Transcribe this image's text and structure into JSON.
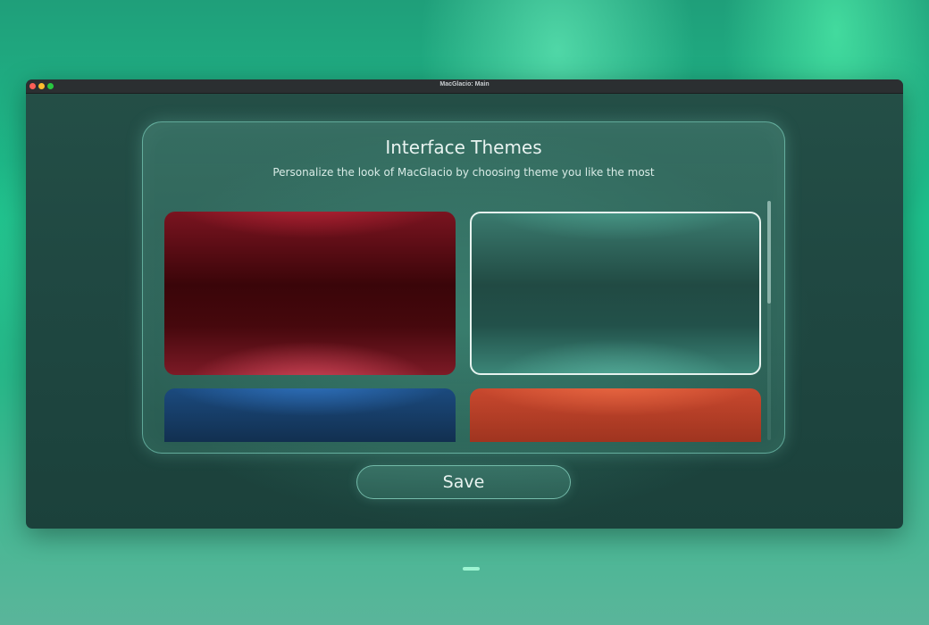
{
  "window": {
    "title": "MacGlacio: Main"
  },
  "panel": {
    "title": "Interface Themes",
    "subtitle": "Personalize the look of MacGlacio by choosing theme you like the most"
  },
  "themes": [
    {
      "name": "red-theme",
      "color": "#3a0509",
      "selected": false
    },
    {
      "name": "glacier-theme",
      "color": "#214a43",
      "selected": true
    },
    {
      "name": "blue-theme",
      "color": "#0d2238",
      "selected": false
    },
    {
      "name": "orange-theme",
      "color": "#c8482e",
      "selected": false
    }
  ],
  "actions": {
    "save_label": "Save"
  },
  "colors": {
    "accent": "#8ce6d2",
    "window_bg": "#1f4741",
    "text": "#e8f3f0"
  }
}
